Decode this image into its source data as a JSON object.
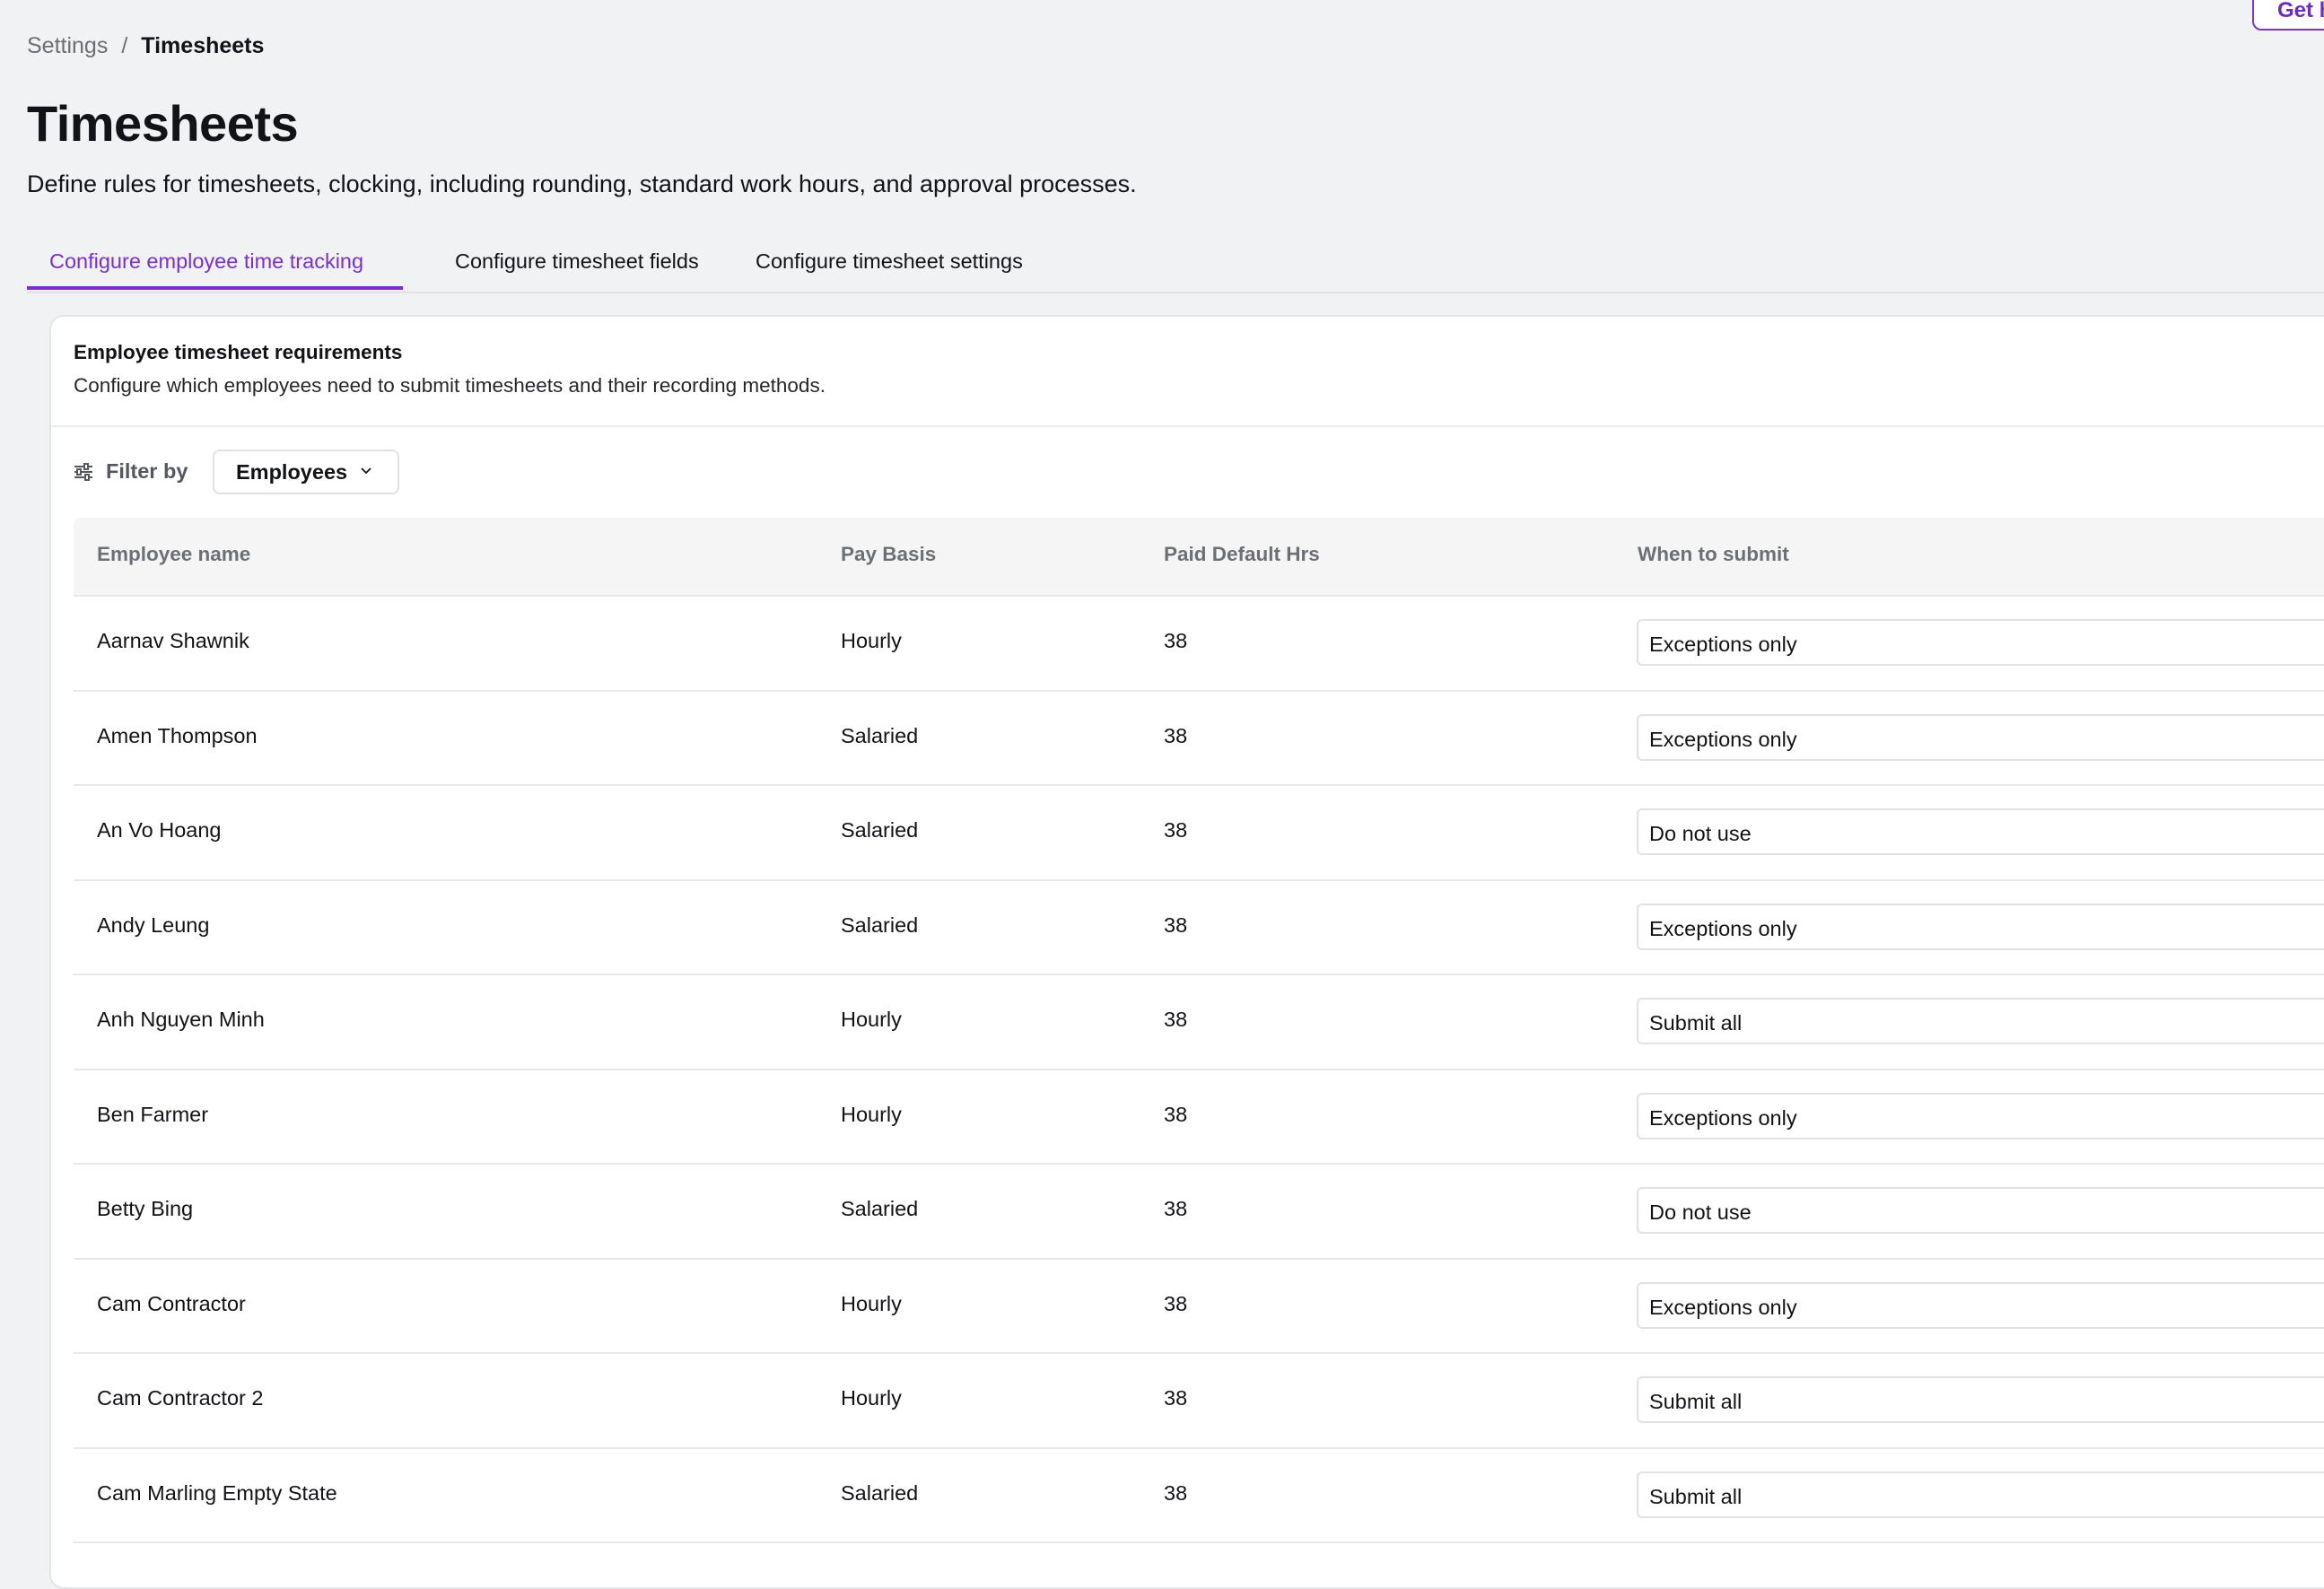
{
  "breadcrumb": {
    "parent": "Settings",
    "separator": "/",
    "current": "Timesheets"
  },
  "header": {
    "help_button": "Get h",
    "title": "Timesheets",
    "description": "Define rules for timesheets, clocking, including rounding, standard work hours, and approval processes."
  },
  "tabs": [
    {
      "label": "Configure employee time tracking",
      "active": true
    },
    {
      "label": "Configure timesheet fields",
      "active": false
    },
    {
      "label": "Configure timesheet settings",
      "active": false
    }
  ],
  "card": {
    "title": "Employee timesheet requirements",
    "description": "Configure which employees need to submit timesheets and their recording methods."
  },
  "filter": {
    "label": "Filter by",
    "value": "Employees",
    "icon": "sliders-icon"
  },
  "table": {
    "columns": [
      "Employee name",
      "Pay Basis",
      "Paid Default Hrs",
      "When to submit"
    ],
    "rows": [
      {
        "name": "Aarnav Shawnik",
        "basis": "Hourly",
        "hours": "38",
        "when": "Exceptions only"
      },
      {
        "name": "Amen Thompson",
        "basis": "Salaried",
        "hours": "38",
        "when": "Exceptions only"
      },
      {
        "name": "An Vo Hoang",
        "basis": "Salaried",
        "hours": "38",
        "when": "Do not use"
      },
      {
        "name": "Andy Leung",
        "basis": "Salaried",
        "hours": "38",
        "when": "Exceptions only"
      },
      {
        "name": "Anh Nguyen Minh",
        "basis": "Hourly",
        "hours": "38",
        "when": "Submit all"
      },
      {
        "name": "Ben Farmer",
        "basis": "Hourly",
        "hours": "38",
        "when": "Exceptions only"
      },
      {
        "name": "Betty Bing",
        "basis": "Salaried",
        "hours": "38",
        "when": "Do not use"
      },
      {
        "name": "Cam Contractor",
        "basis": "Hourly",
        "hours": "38",
        "when": "Exceptions only"
      },
      {
        "name": "Cam Contractor 2",
        "basis": "Hourly",
        "hours": "38",
        "when": "Submit all"
      },
      {
        "name": "Cam Marling Empty State",
        "basis": "Salaried",
        "hours": "38",
        "when": "Submit all"
      }
    ]
  },
  "colors": {
    "accent": "#7a2fd0",
    "background": "#f1f2f4",
    "muted_text": "#6b6f76"
  }
}
